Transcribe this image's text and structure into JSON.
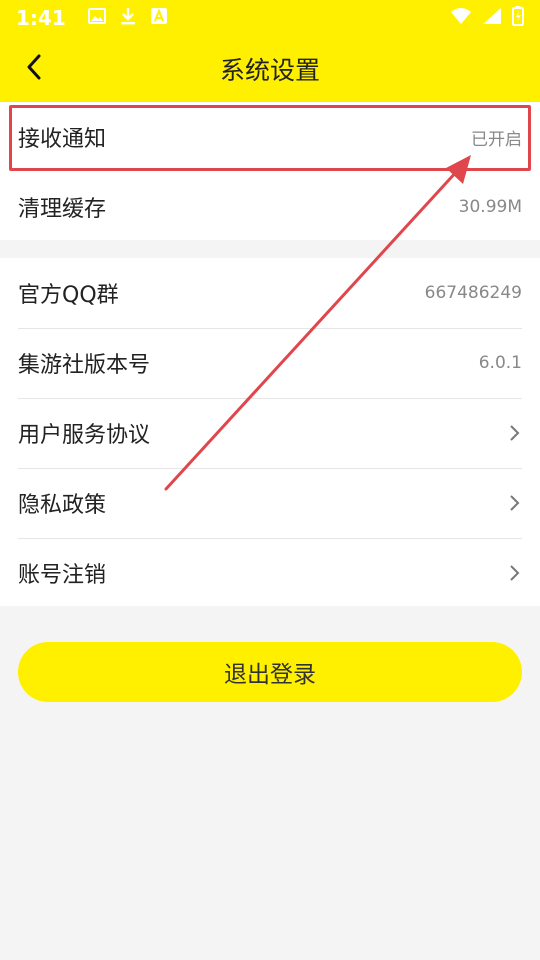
{
  "status_bar": {
    "time": "1:41",
    "icons_left": [
      "image-icon",
      "download-icon",
      "font-icon"
    ],
    "icons_right": [
      "wifi-icon",
      "signal-icon",
      "battery-icon"
    ]
  },
  "header": {
    "title": "系统设置",
    "back_icon": "chevron-left-icon"
  },
  "groups": [
    {
      "items": [
        {
          "label": "接收通知",
          "value": "已开启"
        },
        {
          "label": "清理缓存",
          "value": "30.99M"
        }
      ]
    },
    {
      "items": [
        {
          "label": "官方QQ群",
          "value": "667486249"
        },
        {
          "label": "集游社版本号",
          "value": "6.0.1"
        },
        {
          "label": "用户服务协议"
        },
        {
          "label": "隐私政策"
        },
        {
          "label": "账号注销"
        }
      ]
    }
  ],
  "logout_label": "退出登录",
  "colors": {
    "brand_yellow": "#fff000",
    "annotation_red": "#e0474c",
    "background": "#f4f4f4"
  }
}
